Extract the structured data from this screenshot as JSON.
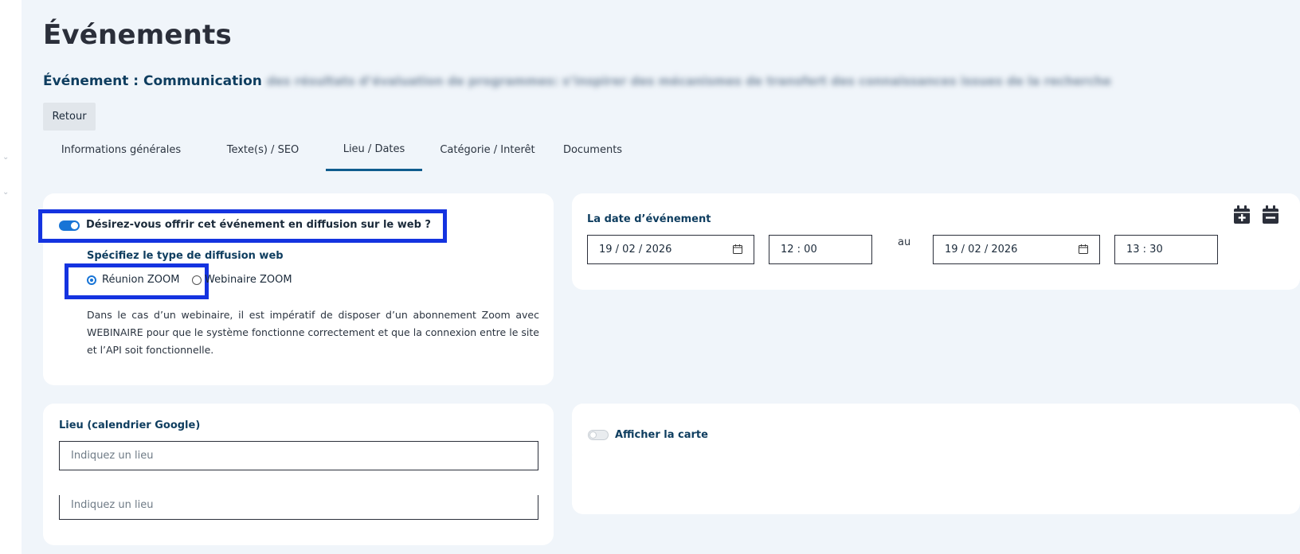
{
  "page": {
    "title": "Événements",
    "event_prefix": "Événement : Communication",
    "event_title_rest": "des résultats d’évaluation de programmes: s’inspirer des mécanismes de transfert des connaissances issues de la recherche",
    "back_label": "Retour"
  },
  "tabs": [
    {
      "label": "Informations générales",
      "active": false
    },
    {
      "label": "Texte(s) / SEO",
      "active": false
    },
    {
      "label": "Lieu / Dates",
      "active": true
    },
    {
      "label": "Catégorie / Interêt",
      "active": false
    },
    {
      "label": "Documents",
      "active": false
    }
  ],
  "web": {
    "toggle_label": "Désirez-vous offrir cet événement en diffusion sur le web ?",
    "toggle_on": true,
    "type_label": "Spécifiez le type de diffusion web",
    "options": [
      {
        "label": "Réunion ZOOM",
        "checked": true
      },
      {
        "label": "Webinaire ZOOM",
        "checked": false
      }
    ],
    "description": "Dans le cas d’un webinaire, il est impératif de disposer d’un abonnement Zoom avec WEBINAIRE pour que le système fonctionne correctement et que la connexion entre le site et l’API soit fonctionnelle."
  },
  "dates": {
    "label": "La date d’événement",
    "start_date": "19 / 02 / 2026",
    "start_time": "12 : 00",
    "separator": "au",
    "end_date": "19 / 02 / 2026",
    "end_time": "13 : 30"
  },
  "lieu": {
    "label": "Lieu (calendrier Google)",
    "placeholder": "Indiquez un lieu",
    "placeholder_duplicate": "Indiquez un lieu"
  },
  "map": {
    "toggle_label": "Afficher la carte",
    "toggle_on": false
  },
  "colors": {
    "accent": "#1874d6",
    "highlight": "#1433e0",
    "heading_blue": "#0e3d5f",
    "tab_underline": "#0f5c8e"
  }
}
